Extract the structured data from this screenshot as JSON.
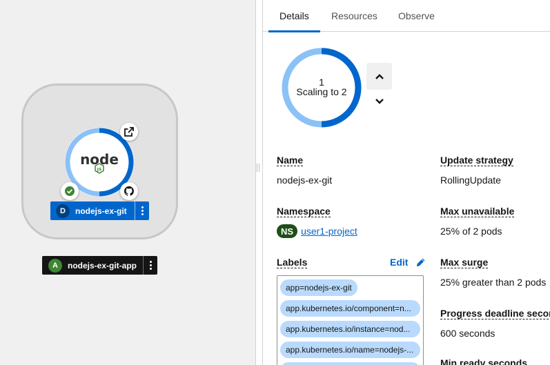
{
  "topology": {
    "node": {
      "kind": "D",
      "name": "nodejs-ex-git",
      "logo_text": "node",
      "logo_sub": "JS"
    },
    "application": {
      "kind": "A",
      "name": "nodejs-ex-git-app"
    }
  },
  "panel": {
    "tabs": [
      {
        "label": "Details",
        "active": true
      },
      {
        "label": "Resources",
        "active": false
      },
      {
        "label": "Observe",
        "active": false
      }
    ],
    "pods": {
      "count": "1",
      "status": "Scaling to 2"
    },
    "details": {
      "name_label": "Name",
      "name_value": "nodejs-ex-git",
      "namespace_label": "Namespace",
      "namespace_badge": "NS",
      "namespace_value": "user1-project",
      "labels_label": "Labels",
      "edit_label": "Edit",
      "labels": [
        "app=nodejs-ex-git",
        "app.kubernetes.io/component=n...",
        "app.kubernetes.io/instance=nod...",
        "app.kubernetes.io/name=nodejs-..."
      ],
      "update_strategy_label": "Update strategy",
      "update_strategy_value": "RollingUpdate",
      "max_unavailable_label": "Max unavailable",
      "max_unavailable_value": "25% of 2 pods",
      "max_surge_label": "Max surge",
      "max_surge_value": "25% greater than 2 pods",
      "progress_deadline_label": "Progress deadline seconds",
      "progress_deadline_value": "600 seconds",
      "min_ready_label": "Min ready seconds"
    }
  },
  "colors": {
    "accent": "#0066cc",
    "pod_light": "#8bc1f7",
    "namespace_badge": "#1e4f18",
    "success": "#3e8635",
    "chip": "#b9dafc"
  },
  "icons": [
    "external-link-icon",
    "check-circle-icon",
    "github-icon",
    "kebab-icon",
    "chevron-up-icon",
    "chevron-down-icon",
    "pencil-icon"
  ]
}
